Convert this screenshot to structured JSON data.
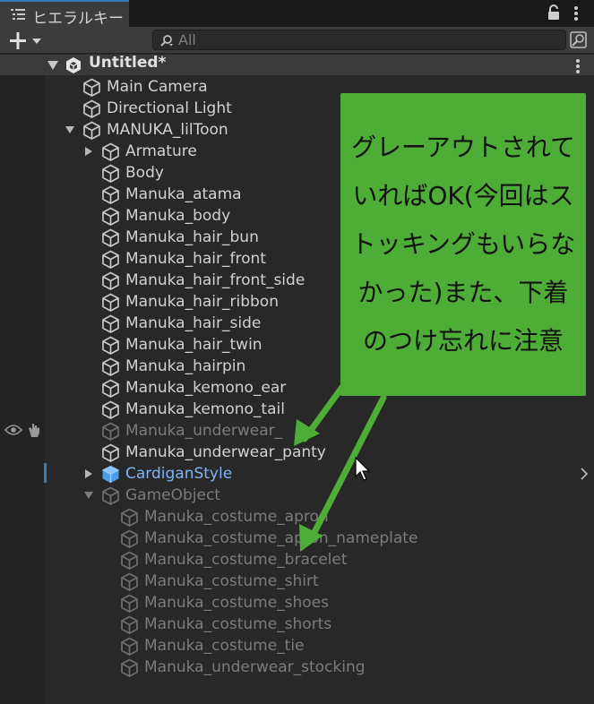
{
  "tab": {
    "title": "ヒエラルキー",
    "icon": "hierarchy-list-icon"
  },
  "toolbar": {
    "add_icon": "plus-icon",
    "search_placeholder": "All",
    "search_icon": "search-icon"
  },
  "scene": {
    "title": "Untitled*",
    "icon": "unity-scene-icon"
  },
  "rows": [
    {
      "label": "Main Camera",
      "depth": 1,
      "state": "normal",
      "expander": "none"
    },
    {
      "label": "Directional Light",
      "depth": 1,
      "state": "normal",
      "expander": "none"
    },
    {
      "label": "MANUKA_lilToon",
      "depth": 1,
      "state": "normal",
      "expander": "expanded"
    },
    {
      "label": "Armature",
      "depth": 2,
      "state": "normal",
      "expander": "collapsed"
    },
    {
      "label": "Body",
      "depth": 2,
      "state": "normal",
      "expander": "none"
    },
    {
      "label": "Manuka_atama",
      "depth": 2,
      "state": "normal",
      "expander": "none"
    },
    {
      "label": "Manuka_body",
      "depth": 2,
      "state": "normal",
      "expander": "none"
    },
    {
      "label": "Manuka_hair_bun",
      "depth": 2,
      "state": "normal",
      "expander": "none"
    },
    {
      "label": "Manuka_hair_front",
      "depth": 2,
      "state": "normal",
      "expander": "none"
    },
    {
      "label": "Manuka_hair_front_side",
      "depth": 2,
      "state": "normal",
      "expander": "none"
    },
    {
      "label": "Manuka_hair_ribbon",
      "depth": 2,
      "state": "normal",
      "expander": "none"
    },
    {
      "label": "Manuka_hair_side",
      "depth": 2,
      "state": "normal",
      "expander": "none"
    },
    {
      "label": "Manuka_hair_twin",
      "depth": 2,
      "state": "normal",
      "expander": "none"
    },
    {
      "label": "Manuka_hairpin",
      "depth": 2,
      "state": "normal",
      "expander": "none"
    },
    {
      "label": "Manuka_kemono_ear",
      "depth": 2,
      "state": "normal",
      "expander": "none"
    },
    {
      "label": "Manuka_kemono_tail",
      "depth": 2,
      "state": "normal",
      "expander": "none"
    },
    {
      "label": "Manuka_underwear_",
      "depth": 2,
      "state": "dim",
      "expander": "none"
    },
    {
      "label": "Manuka_underwear_panty",
      "depth": 2,
      "state": "normal",
      "expander": "none"
    },
    {
      "label": "CardiganStyle",
      "depth": 2,
      "state": "prefab",
      "expander": "collapsed"
    },
    {
      "label": "GameObject",
      "depth": 2,
      "state": "dim",
      "expander": "expanded"
    },
    {
      "label": "Manuka_costume_apron",
      "depth": 3,
      "state": "dim",
      "expander": "none"
    },
    {
      "label": "Manuka_costume_apron_nameplate",
      "depth": 3,
      "state": "dim",
      "expander": "none"
    },
    {
      "label": "Manuka_costume_bracelet",
      "depth": 3,
      "state": "dim",
      "expander": "none"
    },
    {
      "label": "Manuka_costume_shirt",
      "depth": 3,
      "state": "dim",
      "expander": "none"
    },
    {
      "label": "Manuka_costume_shoes",
      "depth": 3,
      "state": "dim",
      "expander": "none"
    },
    {
      "label": "Manuka_costume_shorts",
      "depth": 3,
      "state": "dim",
      "expander": "none"
    },
    {
      "label": "Manuka_costume_tie",
      "depth": 3,
      "state": "dim",
      "expander": "none"
    },
    {
      "label": "Manuka_underwear_stocking",
      "depth": 3,
      "state": "dim",
      "expander": "none"
    }
  ],
  "annotation": {
    "text": "グレーアウトされていればOK(今回はストッキングもいらなかった)また、下着のつけ忘れに注意",
    "color": "#4ead36"
  },
  "colors": {
    "accent": "#3a79bb",
    "prefab": "#7fb4f5",
    "dim": "#7c7c7c"
  }
}
